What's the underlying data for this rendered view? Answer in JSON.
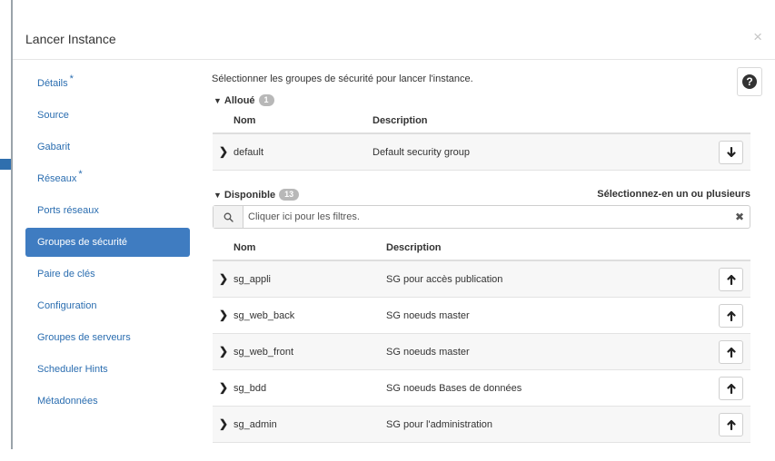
{
  "modal": {
    "title": "Lancer Instance",
    "close_glyph": "×"
  },
  "sidebar": {
    "items": [
      {
        "label": "Détails",
        "required": "*"
      },
      {
        "label": "Source"
      },
      {
        "label": "Gabarit"
      },
      {
        "label": "Réseaux",
        "required": "*"
      },
      {
        "label": "Ports réseaux"
      },
      {
        "label": "Groupes de sécurité",
        "active": true
      },
      {
        "label": "Paire de clés"
      },
      {
        "label": "Configuration"
      },
      {
        "label": "Groupes de serveurs"
      },
      {
        "label": "Scheduler Hints"
      },
      {
        "label": "Métadonnées"
      }
    ]
  },
  "main": {
    "intro": "Sélectionner les groupes de sécurité pour lancer l'instance.",
    "help_glyph": "?",
    "allocated": {
      "label": "Alloué",
      "count": "1",
      "columns": {
        "name": "Nom",
        "description": "Description"
      },
      "rows": [
        {
          "name": "default",
          "description": "Default security group",
          "action_icon": "arrow-down-icon"
        }
      ]
    },
    "available": {
      "label": "Disponible",
      "count": "13",
      "hint": "Sélectionnez-en un ou plusieurs",
      "search_placeholder": "Cliquer ici pour les filtres.",
      "columns": {
        "name": "Nom",
        "description": "Description"
      },
      "rows": [
        {
          "name": "sg_appli",
          "description": "SG pour accès publication",
          "action_icon": "arrow-up-icon"
        },
        {
          "name": "sg_web_back",
          "description": "SG noeuds master",
          "action_icon": "arrow-up-icon"
        },
        {
          "name": "sg_web_front",
          "description": "SG noeuds master",
          "action_icon": "arrow-up-icon"
        },
        {
          "name": "sg_bdd",
          "description": "SG noeuds Bases de données",
          "action_icon": "arrow-up-icon"
        },
        {
          "name": "sg_admin",
          "description": "SG pour l'administration",
          "action_icon": "arrow-up-icon"
        }
      ]
    }
  },
  "colors": {
    "link": "#2a6db0",
    "active_nav": "#3f7cc1",
    "badge": "#b8b8b8"
  }
}
